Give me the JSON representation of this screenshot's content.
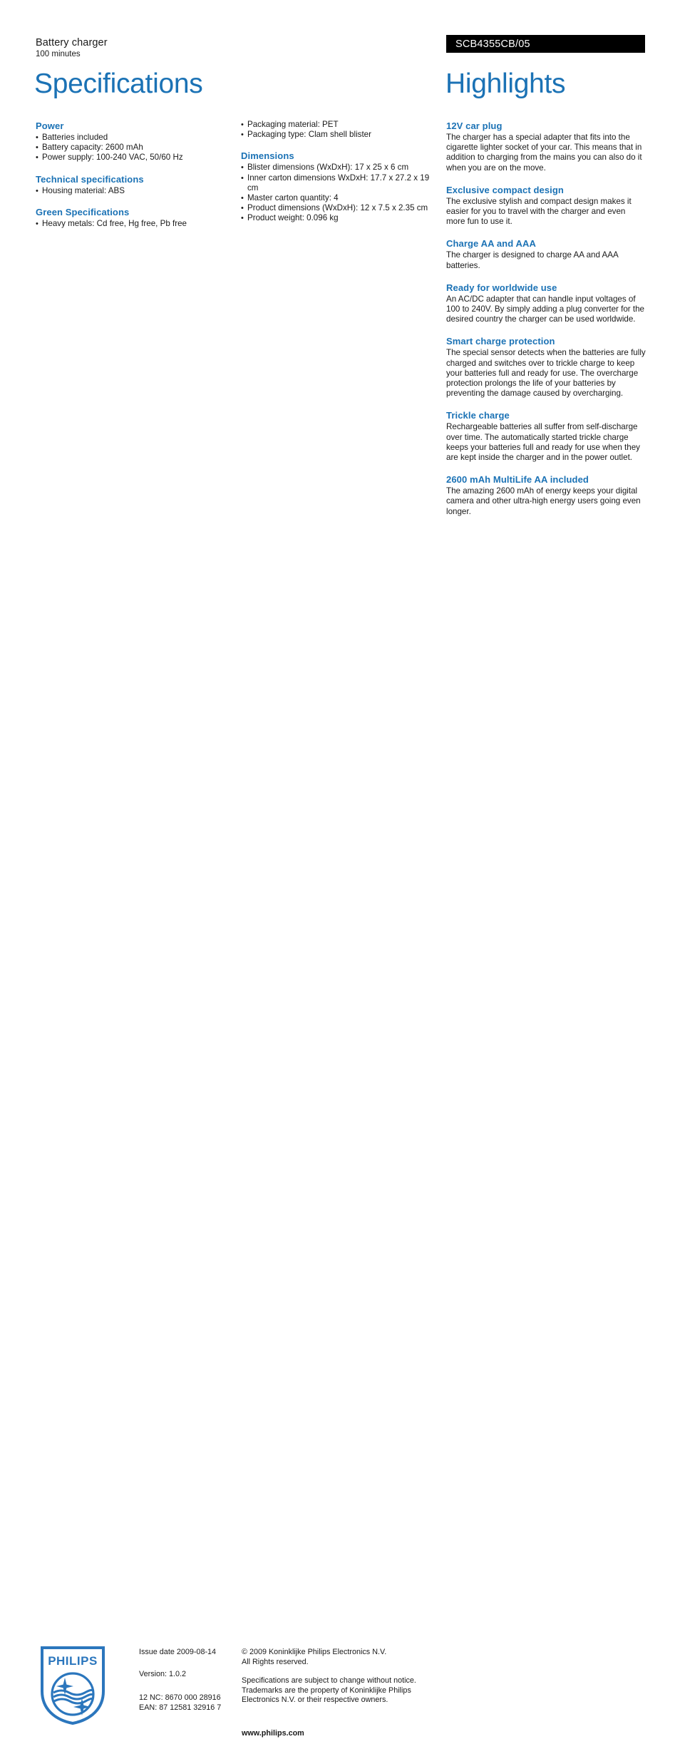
{
  "header": {
    "product_name": "Battery charger",
    "product_subtitle": "100 minutes",
    "product_code": "SCB4355CB/05",
    "left_title": "Specifications",
    "right_title": "Highlights"
  },
  "colors": {
    "accent_blue": "#1b72b5",
    "code_bar_background": "#000000",
    "text": "#1a1a1a"
  },
  "spec_column_1": [
    {
      "heading": "Power",
      "items": [
        "Batteries included",
        "Battery capacity: 2600 mAh",
        "Power supply: 100-240 VAC, 50/60 Hz"
      ]
    },
    {
      "heading": "Technical specifications",
      "items": [
        "Housing material: ABS"
      ]
    },
    {
      "heading": "Green Specifications",
      "items": [
        "Heavy metals: Cd free, Hg free, Pb free"
      ]
    }
  ],
  "spec_column_2": [
    {
      "heading": "",
      "items": [
        "Packaging material: PET",
        "Packaging type: Clam shell blister"
      ]
    },
    {
      "heading": "Dimensions",
      "items": [
        "Blister dimensions (WxDxH): 17 x 25 x 6 cm",
        "Inner carton dimensions WxDxH: 17.7 x 27.2 x 19 cm",
        "Master carton quantity: 4",
        "Product dimensions (WxDxH): 12 x 7.5 x 2.35 cm",
        "Product weight: 0.096 kg"
      ]
    }
  ],
  "highlights": [
    {
      "title": "12V car plug",
      "body": "The charger has a special adapter that fits into the cigarette lighter socket of your car. This means that in addition to charging from the mains you can also do it when you are on the move."
    },
    {
      "title": "Exclusive compact design",
      "body": "The exclusive stylish and compact design makes it easier for you to travel with the charger and even more fun to use it."
    },
    {
      "title": "Charge AA and AAA",
      "body": "The charger is designed to charge AA and AAA batteries."
    },
    {
      "title": "Ready for worldwide use",
      "body": "An AC/DC adapter that can handle input voltages of 100 to 240V. By simply adding a plug converter for the desired country the charger can be used worldwide."
    },
    {
      "title": "Smart charge protection",
      "body": "The special sensor detects when the batteries are fully charged and switches over to trickle charge to keep your batteries full and ready for use. The overcharge protection prolongs the life of your batteries by preventing the damage caused by overcharging."
    },
    {
      "title": "Trickle charge",
      "body": "Rechargeable batteries all suffer from self-discharge over time. The automatically started trickle charge keeps your batteries full and ready for use when they are kept inside the charger and in the power outlet."
    },
    {
      "title": "2600 mAh MultiLife AA included",
      "body": "The amazing 2600 mAh of energy keeps your digital camera and other ultra-high energy users going even longer."
    }
  ],
  "footer": {
    "logo_wordmark": "PHILIPS",
    "issue_date": "Issue date 2009-08-14",
    "version": "Version: 1.0.2",
    "nc_code": "12 NC: 8670 000 28916",
    "ean_code": "EAN: 87 12581 32916 7",
    "copyright_line_1": "© 2009 Koninklijke Philips Electronics N.V.",
    "copyright_line_2": "All Rights reserved.",
    "disclaimer_line_1": "Specifications are subject to change without notice.",
    "disclaimer_line_2": "Trademarks are the property of Koninklijke Philips",
    "disclaimer_line_3": "Electronics N.V. or their respective owners.",
    "website": "www.philips.com"
  }
}
